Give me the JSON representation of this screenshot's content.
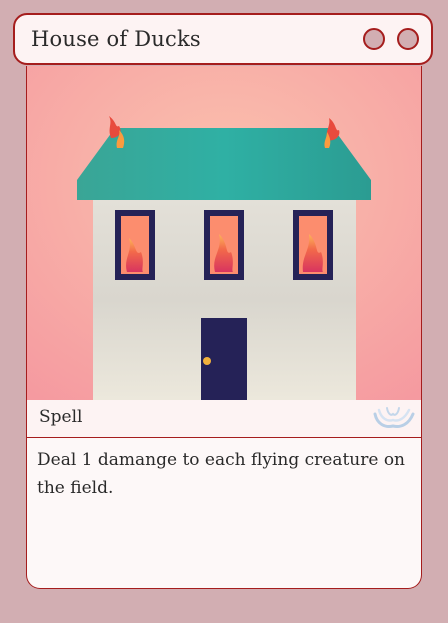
{
  "card": {
    "name": "House of Ducks",
    "type": "Spell",
    "rules_text": "Deal 1 damange to each flying creature on the field.",
    "type_icon": "water-wave-icon",
    "title_buttons": [
      "circle-button",
      "circle-button"
    ]
  },
  "colors": {
    "background": "#d2aeb2",
    "border": "#a51d1d",
    "panel": "#fdf3f3",
    "roof": "#2fa89c",
    "wall": "#e8e4d9",
    "door": "#252257",
    "sky": "#f7aaa0"
  }
}
